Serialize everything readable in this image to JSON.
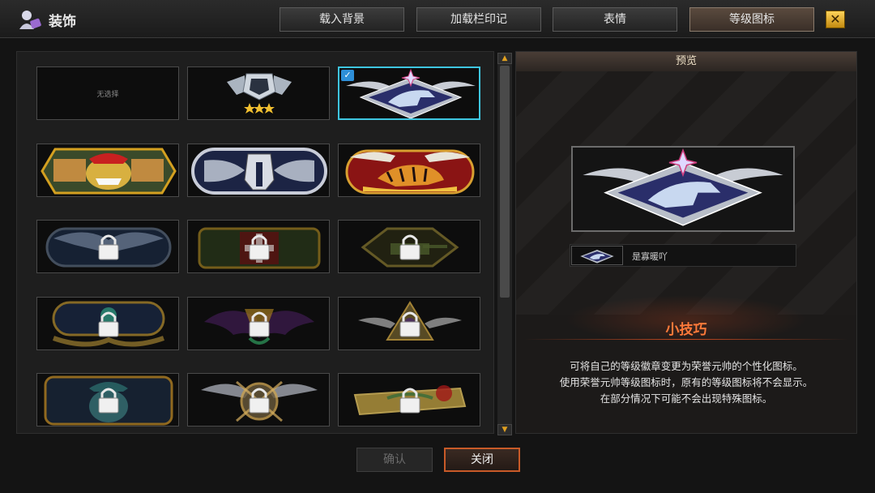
{
  "app": {
    "title": "装饰",
    "icon": "user-decoration-icon"
  },
  "tabs": [
    {
      "label": "载入背景",
      "active": false
    },
    {
      "label": "加载栏印记",
      "active": false
    },
    {
      "label": "表情",
      "active": false
    },
    {
      "label": "等级图标",
      "active": true
    }
  ],
  "close_icon": "close-x-icon",
  "grid": {
    "cells": [
      {
        "badge": "none",
        "label": "无选择",
        "locked": false,
        "selected": false
      },
      {
        "badge": "silver-stars-badge",
        "locked": false,
        "selected": false
      },
      {
        "badge": "dragon-wings-badge",
        "locked": false,
        "selected": true
      },
      {
        "badge": "bulldog-badge",
        "locked": false,
        "selected": false
      },
      {
        "badge": "spartan-helmet-badge",
        "locked": false,
        "selected": false
      },
      {
        "badge": "tiger-wings-badge",
        "locked": false,
        "selected": false
      },
      {
        "badge": "eagle-chain-badge",
        "locked": true,
        "selected": false
      },
      {
        "badge": "iron-cross-badge",
        "locked": true,
        "selected": false
      },
      {
        "badge": "tank-badge",
        "locked": true,
        "selected": false
      },
      {
        "badge": "laurel-medal-badge",
        "locked": true,
        "selected": false
      },
      {
        "badge": "bat-wings-badge",
        "locked": true,
        "selected": false
      },
      {
        "badge": "pyramid-eye-badge",
        "locked": true,
        "selected": false
      },
      {
        "badge": "general-portrait-badge",
        "locked": true,
        "selected": false
      },
      {
        "badge": "crossed-swords-badge",
        "locked": true,
        "selected": false
      },
      {
        "badge": "rose-badge",
        "locked": true,
        "selected": false
      }
    ]
  },
  "preview": {
    "header": "预览",
    "badge": "dragon-wings-badge",
    "name": "是寡暖吖",
    "tips_title": "小技巧",
    "tips_lines": [
      "可将自己的等级徽章变更为荣誉元帅的个性化图标。",
      "使用荣誉元帅等级图标时，原有的等级图标将不会显示。",
      "在部分情况下可能不会出现特殊图标。"
    ]
  },
  "buttons": {
    "confirm": "确认",
    "close": "关闭"
  },
  "colors": {
    "accent_orange": "#c85a28",
    "tips_title": "#ff7a3a",
    "selected_border": "#3ec6e0",
    "lock_gold": "#e0a020"
  }
}
